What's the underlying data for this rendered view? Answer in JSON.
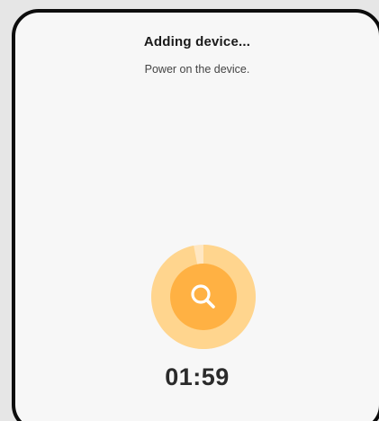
{
  "dialog": {
    "title": "Adding device...",
    "subtitle": "Power on the device."
  },
  "scanner": {
    "icon": "search-icon",
    "progress": 0.97,
    "colors": {
      "outer_ring": "#ffd58e",
      "outer_ring_light": "#ffe7c2",
      "inner_circle": "#ffb143",
      "icon": "#ffffff"
    }
  },
  "countdown": {
    "time": "01:59"
  }
}
